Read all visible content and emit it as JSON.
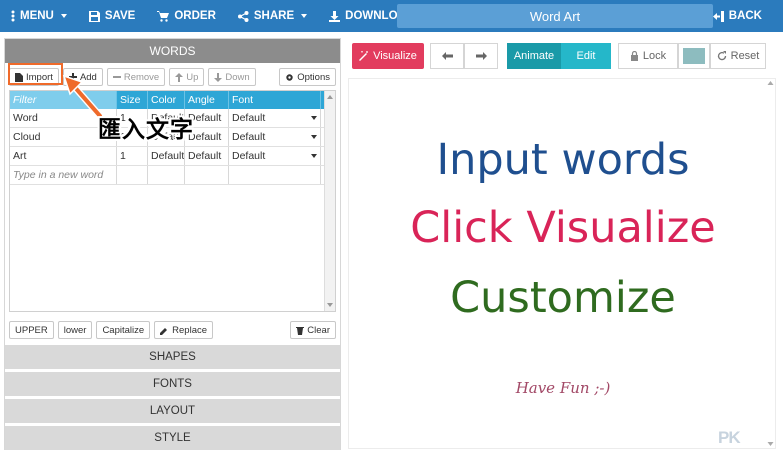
{
  "topbar": {
    "menu": "MENU",
    "save": "SAVE",
    "order": "ORDER",
    "share": "SHARE",
    "download": "DOWNLOAD",
    "title": "Word Art",
    "back": "BACK"
  },
  "words_panel": {
    "title": "WORDS",
    "toolbar": {
      "import": "Import",
      "add": "Add",
      "remove": "Remove",
      "up": "Up",
      "down": "Down",
      "options": "Options"
    },
    "columns": [
      "Filter",
      "Size",
      "Color",
      "Angle",
      "Font"
    ],
    "rows": [
      {
        "word": "Word",
        "size": "1",
        "color": "Default",
        "angle": "Default",
        "font": "Default"
      },
      {
        "word": "Cloud",
        "size": "1",
        "color": "Default",
        "angle": "Default",
        "font": "Default"
      },
      {
        "word": "Art",
        "size": "1",
        "color": "Default",
        "angle": "Default",
        "font": "Default"
      }
    ],
    "new_word_placeholder": "Type in a new word",
    "case_buttons": {
      "upper": "UPPER",
      "lower": "lower",
      "capitalize": "Capitalize",
      "replace": "Replace"
    },
    "clear": "Clear"
  },
  "sections": [
    "SHAPES",
    "FONTS",
    "LAYOUT",
    "STYLE"
  ],
  "annotation": {
    "label": "匯入文字"
  },
  "right_toolbar": {
    "visualize": "Visualize",
    "animate": "Animate",
    "edit": "Edit",
    "lock": "Lock",
    "reset": "Reset",
    "swatch_color": "#8dbcbf"
  },
  "canvas": {
    "lines": [
      {
        "text": "Input words",
        "color": "#1f4f8f"
      },
      {
        "text": "Click Visualize",
        "color": "#d92458"
      },
      {
        "text": "Customize",
        "color": "#2f6b1f"
      },
      {
        "text": "Have Fun ;-)",
        "color": "#a24866"
      }
    ],
    "watermark": "PK"
  },
  "colors": {
    "topbar": "#2b7bbd",
    "accent": "#2ea6d6",
    "visualize": "#e23c5e",
    "annotation": "#ef6a2a"
  }
}
